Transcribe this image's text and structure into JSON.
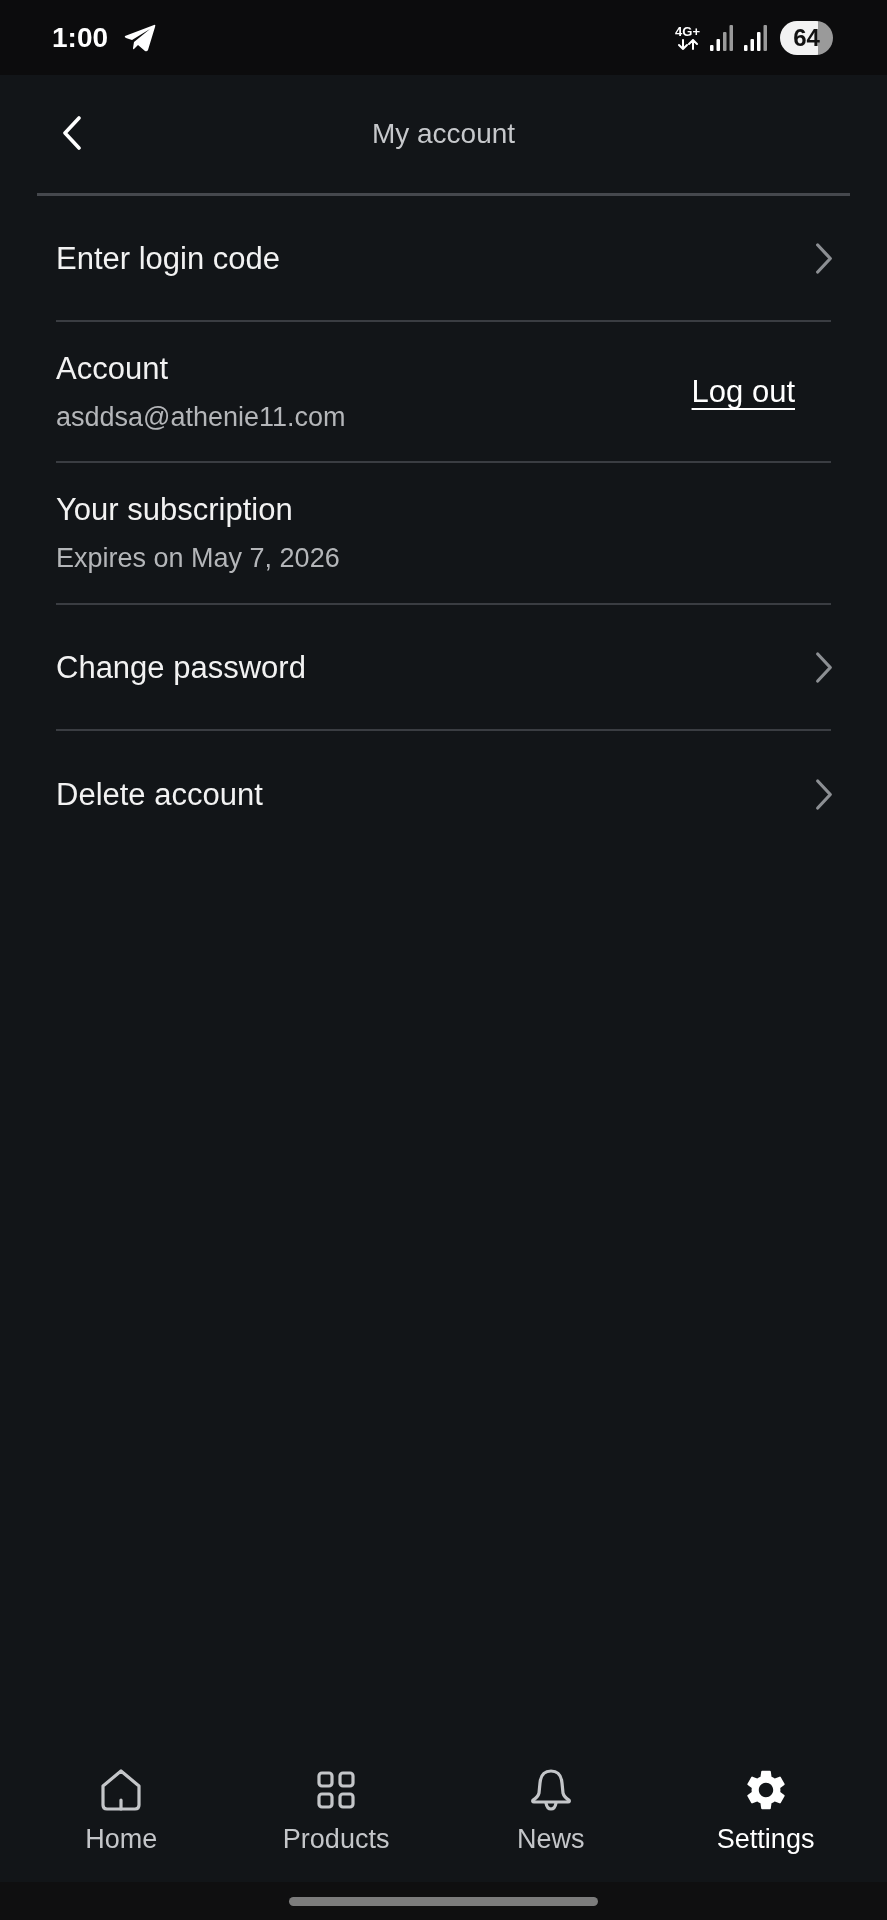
{
  "status_bar": {
    "time": "1:00",
    "network": "4G+",
    "battery": "64"
  },
  "header": {
    "title": "My account"
  },
  "rows": [
    {
      "kind": "link",
      "title": "Enter login code"
    },
    {
      "kind": "action",
      "title": "Account",
      "subtitle": "asddsa@athenie11.com",
      "action": "Log out"
    },
    {
      "kind": "info",
      "title": "Your subscription",
      "subtitle": "Expires on May 7, 2026"
    },
    {
      "kind": "link",
      "title": "Change password"
    },
    {
      "kind": "link",
      "title": "Delete account"
    }
  ],
  "nav": [
    {
      "label": "Home",
      "selected": false
    },
    {
      "label": "Products",
      "selected": false
    },
    {
      "label": "News",
      "selected": false
    },
    {
      "label": "Settings",
      "selected": true
    }
  ]
}
